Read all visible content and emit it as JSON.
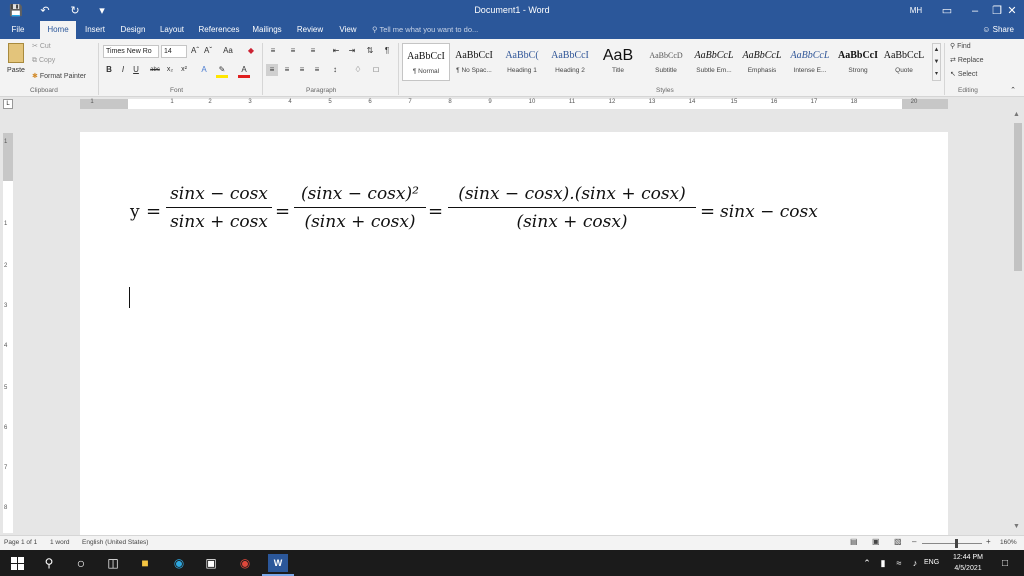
{
  "window": {
    "title": "Document1 - Word",
    "user_initials": "MH"
  },
  "tabs": [
    {
      "label": "File"
    },
    {
      "label": "Home",
      "active": true
    },
    {
      "label": "Insert"
    },
    {
      "label": "Design"
    },
    {
      "label": "Layout"
    },
    {
      "label": "References"
    },
    {
      "label": "Mailings"
    },
    {
      "label": "Review"
    },
    {
      "label": "View"
    }
  ],
  "tell_me_placeholder": "Tell me what you want to do...",
  "share_label": "Share",
  "clipboard": {
    "paste": "Paste",
    "cut": "Cut",
    "copy": "Copy",
    "format_painter": "Format Painter",
    "group": "Clipboard"
  },
  "font": {
    "name": "Times New Ro",
    "size": "14",
    "group": "Font"
  },
  "paragraph": {
    "group": "Paragraph"
  },
  "styles": {
    "group": "Styles",
    "items": [
      {
        "preview": "AaBbCcI",
        "name": "¶ Normal"
      },
      {
        "preview": "AaBbCcI",
        "name": "¶ No Spac..."
      },
      {
        "preview": "AaBbC(",
        "name": "Heading 1"
      },
      {
        "preview": "AaBbCcI",
        "name": "Heading 2"
      },
      {
        "preview": "AaB",
        "name": "Title"
      },
      {
        "preview": "AaBbCcD",
        "name": "Subtitle"
      },
      {
        "preview": "AaBbCcL",
        "name": "Subtle Em..."
      },
      {
        "preview": "AaBbCcL",
        "name": "Emphasis"
      },
      {
        "preview": "AaBbCcL",
        "name": "Intense E..."
      },
      {
        "preview": "AaBbCcI",
        "name": "Strong"
      },
      {
        "preview": "AaBbCcL",
        "name": "Quote"
      }
    ]
  },
  "editing": {
    "find": "Find",
    "replace": "Replace",
    "select": "Select",
    "group": "Editing"
  },
  "ruler": {
    "numbers": [
      "1",
      "1",
      "2",
      "3",
      "4",
      "5",
      "6",
      "7",
      "8",
      "9",
      "10",
      "11",
      "12",
      "13",
      "14",
      "15",
      "16",
      "17",
      "18",
      "20"
    ]
  },
  "vruler": {
    "numbers": [
      "1",
      "1",
      "2",
      "3",
      "4",
      "5",
      "6",
      "7",
      "8"
    ]
  },
  "equation": {
    "lhs": "y",
    "eq": "=",
    "f1_num": "sinx − cosx",
    "f1_den": "sinx + cosx",
    "f2_num": "(sinx − cosx)²",
    "f2_den": "(sinx + cosx)",
    "f3_num": "(sinx − cosx).(sinx + cosx)",
    "f3_den": "(sinx + cosx)",
    "rhs": "sinx − cosx"
  },
  "status": {
    "page": "Page 1 of 1",
    "words": "1 word",
    "language": "English (United States)",
    "zoom": "160%"
  },
  "taskbar": {
    "time": "12:44 PM",
    "date": "4/5/2021",
    "lang": "ENG"
  },
  "colors": {
    "word_blue": "#2b579a",
    "ribbon_bg": "#f3f3f3",
    "taskbar_bg": "#1b1b1b"
  }
}
